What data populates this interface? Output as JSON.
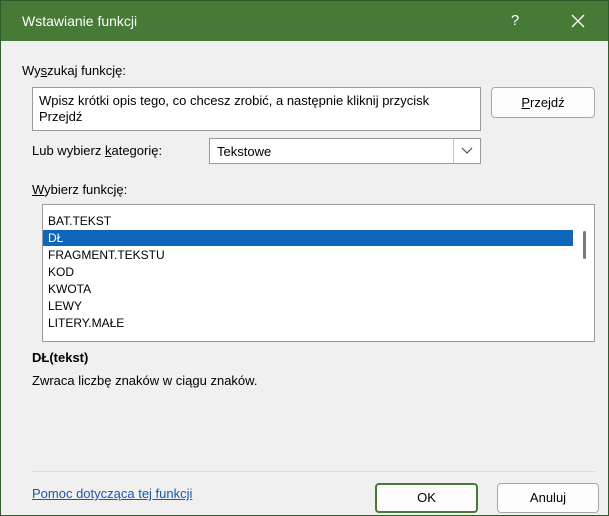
{
  "window": {
    "title": "Wstawianie funkcji",
    "help_glyph": "?",
    "title_bar_color": "#467a36"
  },
  "search": {
    "label_pre": "Wy",
    "label_accel": "s",
    "label_post": "zukaj funkcję:",
    "text": "Wpisz krótki opis tego, co chcesz zrobić, a następnie kliknij przycisk Przejdź",
    "go_pre": "",
    "go_accel": "P",
    "go_post": "rzejdź"
  },
  "category": {
    "label_pre": "Lub wybierz ",
    "label_accel": "k",
    "label_post": "ategorię:",
    "selected": "Tekstowe"
  },
  "functions": {
    "label_pre": "",
    "label_accel": "W",
    "label_post": "ybierz funkcję:",
    "items": [
      {
        "label": "BAT.TEKST",
        "selected": false
      },
      {
        "label": "DŁ",
        "selected": true
      },
      {
        "label": "FRAGMENT.TEKSTU",
        "selected": false
      },
      {
        "label": "KOD",
        "selected": false
      },
      {
        "label": "KWOTA",
        "selected": false
      },
      {
        "label": "LEWY",
        "selected": false
      },
      {
        "label": "LITERY.MAŁE",
        "selected": false
      }
    ],
    "selection_color": "#0f65b9"
  },
  "details": {
    "signature": "DŁ(tekst)",
    "description": "Zwraca liczbę znaków w ciągu znaków."
  },
  "footer": {
    "help_link": "Pomoc dotycząca tej funkcji",
    "ok_label": "OK",
    "cancel_label": "Anuluj"
  },
  "icons": {
    "close": "close-icon",
    "dropdown": "chevron-down-icon"
  }
}
